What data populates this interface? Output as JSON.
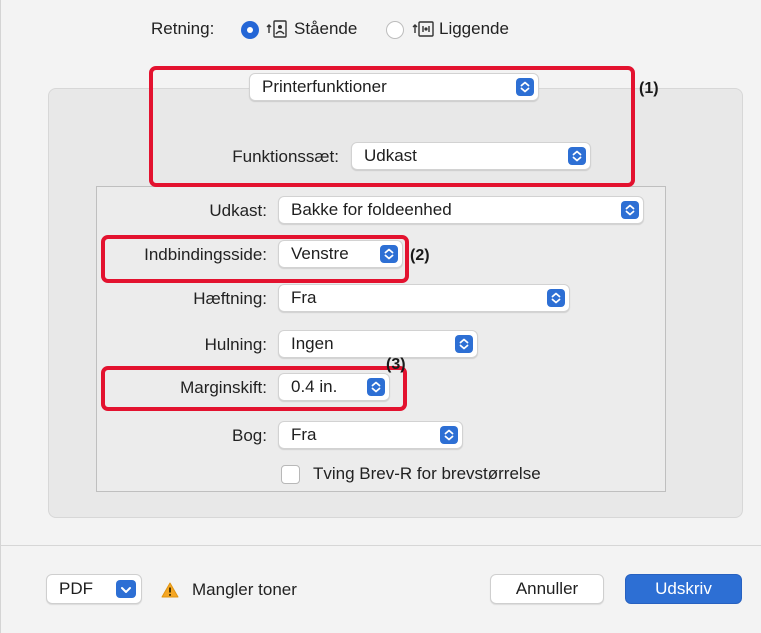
{
  "orientation": {
    "label": "Retning:",
    "options": [
      {
        "label": "Stående",
        "selected": true
      },
      {
        "label": "Liggende",
        "selected": false
      }
    ]
  },
  "section_popup": {
    "value": "Printerfunktioner"
  },
  "feature_set": {
    "label": "Funktionssæt:",
    "value": "Udkast"
  },
  "settings": {
    "udkast": {
      "label": "Udkast:",
      "value": "Bakke for foldeenhed"
    },
    "binding": {
      "label": "Indbindingsside:",
      "value": "Venstre"
    },
    "stapling": {
      "label": "Hæftning:",
      "value": "Fra"
    },
    "punching": {
      "label": "Hulning:",
      "value": "Ingen"
    },
    "margin": {
      "label": "Marginskift:",
      "value": "0.4 in."
    },
    "book": {
      "label": "Bog:",
      "value": "Fra"
    },
    "force_letter": {
      "label": "Tving Brev-R for brevstørrelse",
      "checked": false
    }
  },
  "callouts": [
    "(1)",
    "(2)",
    "(3)"
  ],
  "footer": {
    "pdf_label": "PDF",
    "warning_text": "Mangler toner",
    "cancel_label": "Annuller",
    "print_label": "Udskriv"
  },
  "colors": {
    "accent": "#2d6fd4",
    "callout": "#e3122f",
    "warning": "#f5a623"
  },
  "icons": [
    "portrait-orientation-icon",
    "landscape-orientation-icon",
    "updown-chevron-icon",
    "chevron-down-icon",
    "warning-icon"
  ]
}
